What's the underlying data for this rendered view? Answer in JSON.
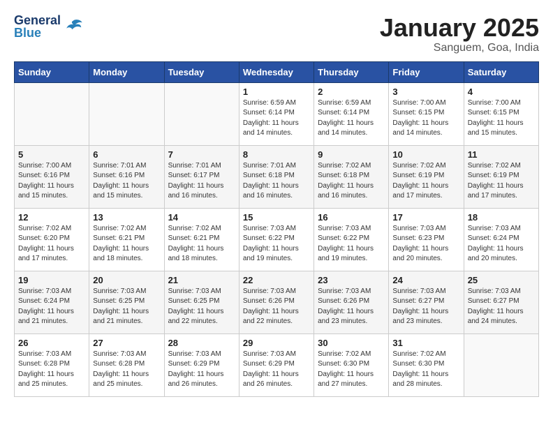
{
  "header": {
    "logo_general": "General",
    "logo_blue": "Blue",
    "month": "January 2025",
    "location": "Sanguem, Goa, India"
  },
  "days_of_week": [
    "Sunday",
    "Monday",
    "Tuesday",
    "Wednesday",
    "Thursday",
    "Friday",
    "Saturday"
  ],
  "weeks": [
    [
      {
        "day": "",
        "info": ""
      },
      {
        "day": "",
        "info": ""
      },
      {
        "day": "",
        "info": ""
      },
      {
        "day": "1",
        "info": "Sunrise: 6:59 AM\nSunset: 6:14 PM\nDaylight: 11 hours\nand 14 minutes."
      },
      {
        "day": "2",
        "info": "Sunrise: 6:59 AM\nSunset: 6:14 PM\nDaylight: 11 hours\nand 14 minutes."
      },
      {
        "day": "3",
        "info": "Sunrise: 7:00 AM\nSunset: 6:15 PM\nDaylight: 11 hours\nand 14 minutes."
      },
      {
        "day": "4",
        "info": "Sunrise: 7:00 AM\nSunset: 6:15 PM\nDaylight: 11 hours\nand 15 minutes."
      }
    ],
    [
      {
        "day": "5",
        "info": "Sunrise: 7:00 AM\nSunset: 6:16 PM\nDaylight: 11 hours\nand 15 minutes."
      },
      {
        "day": "6",
        "info": "Sunrise: 7:01 AM\nSunset: 6:16 PM\nDaylight: 11 hours\nand 15 minutes."
      },
      {
        "day": "7",
        "info": "Sunrise: 7:01 AM\nSunset: 6:17 PM\nDaylight: 11 hours\nand 16 minutes."
      },
      {
        "day": "8",
        "info": "Sunrise: 7:01 AM\nSunset: 6:18 PM\nDaylight: 11 hours\nand 16 minutes."
      },
      {
        "day": "9",
        "info": "Sunrise: 7:02 AM\nSunset: 6:18 PM\nDaylight: 11 hours\nand 16 minutes."
      },
      {
        "day": "10",
        "info": "Sunrise: 7:02 AM\nSunset: 6:19 PM\nDaylight: 11 hours\nand 17 minutes."
      },
      {
        "day": "11",
        "info": "Sunrise: 7:02 AM\nSunset: 6:19 PM\nDaylight: 11 hours\nand 17 minutes."
      }
    ],
    [
      {
        "day": "12",
        "info": "Sunrise: 7:02 AM\nSunset: 6:20 PM\nDaylight: 11 hours\nand 17 minutes."
      },
      {
        "day": "13",
        "info": "Sunrise: 7:02 AM\nSunset: 6:21 PM\nDaylight: 11 hours\nand 18 minutes."
      },
      {
        "day": "14",
        "info": "Sunrise: 7:02 AM\nSunset: 6:21 PM\nDaylight: 11 hours\nand 18 minutes."
      },
      {
        "day": "15",
        "info": "Sunrise: 7:03 AM\nSunset: 6:22 PM\nDaylight: 11 hours\nand 19 minutes."
      },
      {
        "day": "16",
        "info": "Sunrise: 7:03 AM\nSunset: 6:22 PM\nDaylight: 11 hours\nand 19 minutes."
      },
      {
        "day": "17",
        "info": "Sunrise: 7:03 AM\nSunset: 6:23 PM\nDaylight: 11 hours\nand 20 minutes."
      },
      {
        "day": "18",
        "info": "Sunrise: 7:03 AM\nSunset: 6:24 PM\nDaylight: 11 hours\nand 20 minutes."
      }
    ],
    [
      {
        "day": "19",
        "info": "Sunrise: 7:03 AM\nSunset: 6:24 PM\nDaylight: 11 hours\nand 21 minutes."
      },
      {
        "day": "20",
        "info": "Sunrise: 7:03 AM\nSunset: 6:25 PM\nDaylight: 11 hours\nand 21 minutes."
      },
      {
        "day": "21",
        "info": "Sunrise: 7:03 AM\nSunset: 6:25 PM\nDaylight: 11 hours\nand 22 minutes."
      },
      {
        "day": "22",
        "info": "Sunrise: 7:03 AM\nSunset: 6:26 PM\nDaylight: 11 hours\nand 22 minutes."
      },
      {
        "day": "23",
        "info": "Sunrise: 7:03 AM\nSunset: 6:26 PM\nDaylight: 11 hours\nand 23 minutes."
      },
      {
        "day": "24",
        "info": "Sunrise: 7:03 AM\nSunset: 6:27 PM\nDaylight: 11 hours\nand 23 minutes."
      },
      {
        "day": "25",
        "info": "Sunrise: 7:03 AM\nSunset: 6:27 PM\nDaylight: 11 hours\nand 24 minutes."
      }
    ],
    [
      {
        "day": "26",
        "info": "Sunrise: 7:03 AM\nSunset: 6:28 PM\nDaylight: 11 hours\nand 25 minutes."
      },
      {
        "day": "27",
        "info": "Sunrise: 7:03 AM\nSunset: 6:28 PM\nDaylight: 11 hours\nand 25 minutes."
      },
      {
        "day": "28",
        "info": "Sunrise: 7:03 AM\nSunset: 6:29 PM\nDaylight: 11 hours\nand 26 minutes."
      },
      {
        "day": "29",
        "info": "Sunrise: 7:03 AM\nSunset: 6:29 PM\nDaylight: 11 hours\nand 26 minutes."
      },
      {
        "day": "30",
        "info": "Sunrise: 7:02 AM\nSunset: 6:30 PM\nDaylight: 11 hours\nand 27 minutes."
      },
      {
        "day": "31",
        "info": "Sunrise: 7:02 AM\nSunset: 6:30 PM\nDaylight: 11 hours\nand 28 minutes."
      },
      {
        "day": "",
        "info": ""
      }
    ]
  ]
}
